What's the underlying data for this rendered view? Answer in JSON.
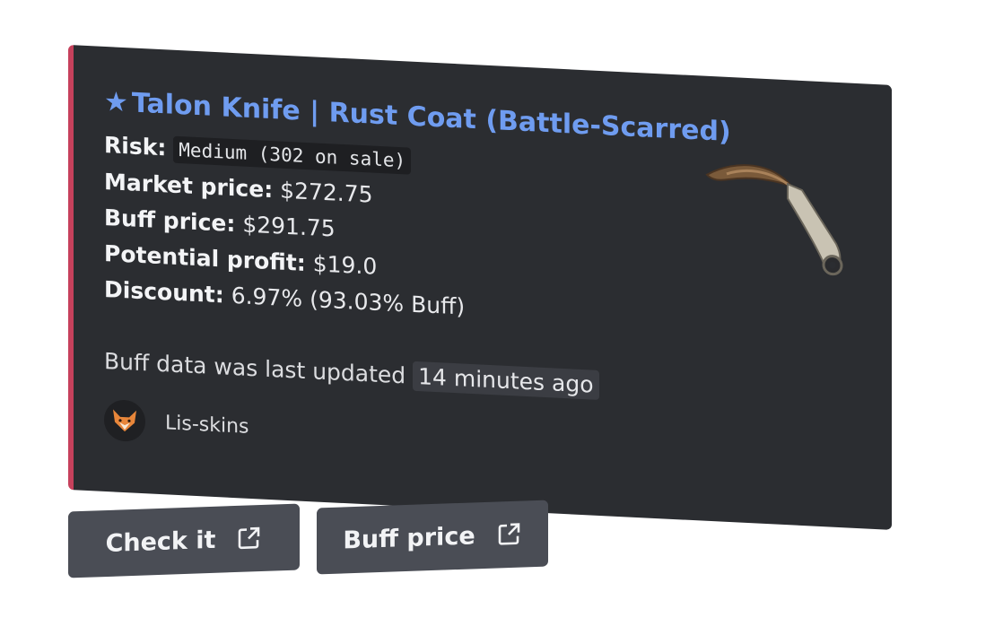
{
  "embed": {
    "accent_color": "#c6415c",
    "title_star": "★",
    "title": "Talon Knife | Rust Coat (Battle-Scarred)",
    "rows": {
      "risk_label": "Risk:",
      "risk_value": "Medium (302 on sale)",
      "market_label": "Market price:",
      "market_value": "$272.75",
      "buff_label": "Buff price:",
      "buff_value": "$291.75",
      "profit_label": "Potential profit:",
      "profit_value": "$19.0",
      "discount_label": "Discount:",
      "discount_value": "6.97% (93.03% Buff)"
    },
    "updated_text": "Buff data was last updated",
    "updated_timestamp": "14 minutes ago",
    "footer": {
      "author": "Lis-skins",
      "avatar_icon": "fox-icon"
    },
    "thumbnail_icon": "knife-icon"
  },
  "buttons": {
    "check_label": "Check it",
    "buff_label": "Buff price",
    "external_icon": "external-link-icon"
  }
}
